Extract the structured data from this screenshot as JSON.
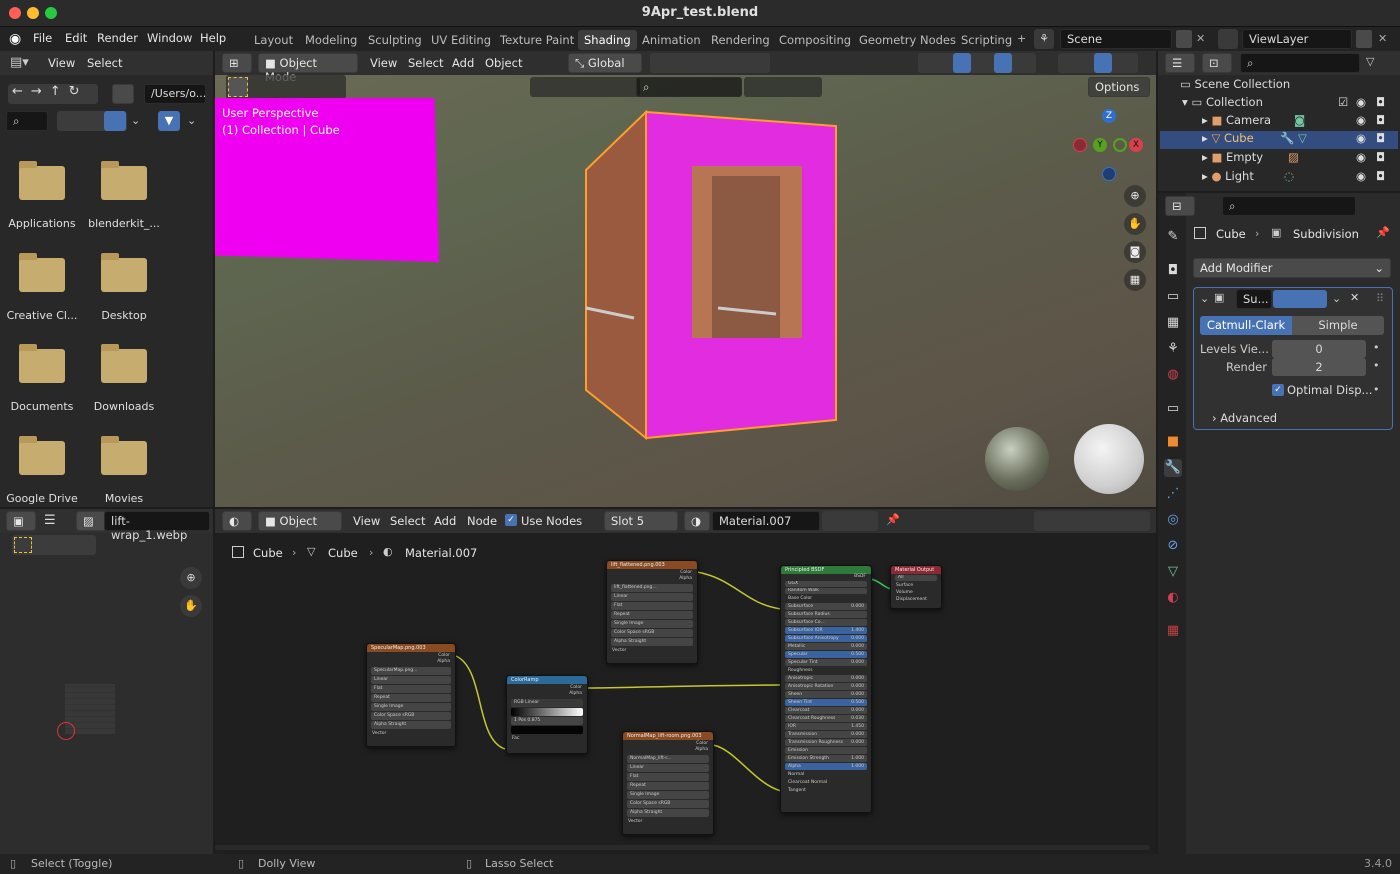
{
  "app": {
    "file_title": "9Apr_test.blend",
    "version": "3.4.0"
  },
  "menu": [
    "File",
    "Edit",
    "Render",
    "Window",
    "Help"
  ],
  "workspaces": [
    "Layout",
    "Modeling",
    "Sculpting",
    "UV Editing",
    "Texture Paint",
    "Shading",
    "Animation",
    "Rendering",
    "Compositing",
    "Geometry Nodes",
    "Scripting"
  ],
  "active_workspace": "Shading",
  "scene_field": "Scene",
  "viewlayer_field": "ViewLayer",
  "file_browser": {
    "menu": [
      "View",
      "Select"
    ],
    "path": "/Users/o...",
    "items": [
      "Applications",
      "blenderkit_...",
      "Creative Cl...",
      "Desktop",
      "Documents",
      "Downloads",
      "Google Drive",
      "Movies"
    ]
  },
  "viewport": {
    "mode": "Object Mode",
    "menu": [
      "View",
      "Select",
      "Add",
      "Object"
    ],
    "orientation": "Global",
    "options": "Options",
    "overlay_line1": "User Perspective",
    "overlay_line2": "(1) Collection | Cube"
  },
  "image_editor": {
    "image_name": "lift-wrap_1.webp"
  },
  "node_editor": {
    "type": "Object",
    "menu": [
      "View",
      "Select",
      "Add",
      "Node"
    ],
    "use_nodes": "Use Nodes",
    "slot": "Slot 5",
    "material": "Material.007",
    "breadcrumb": [
      "Cube",
      "Cube",
      "Material.007"
    ]
  },
  "nodes": {
    "lift": {
      "title": "lift_flattened.png.003",
      "image": "lift_flattened.png...",
      "outputs": [
        "Color",
        "Alpha"
      ],
      "rows": [
        "Linear",
        "Flat",
        "Repeat",
        "Single Image"
      ],
      "color_space": "Color Space",
      "color_space_val": "sRGB",
      "alpha": "Alpha",
      "alpha_val": "Straight",
      "input": "Vector"
    },
    "spec": {
      "title": "SpecularMap.png.003",
      "image": "SpecularMap.png...",
      "outputs": [
        "Color",
        "Alpha"
      ],
      "rows": [
        "Linear",
        "Flat",
        "Repeat",
        "Single Image"
      ],
      "color_space": "Color Space",
      "color_space_val": "sRGB",
      "alpha": "Alpha",
      "alpha_val": "Straight",
      "input": "Vector"
    },
    "ramp": {
      "title": "ColorRamp",
      "outputs": [
        "Color",
        "Alpha"
      ],
      "mode": "RGB",
      "interp": "Linear",
      "pos_label": "Pos",
      "pos_val": "0.875",
      "index": "1",
      "input": "Fac"
    },
    "normal": {
      "title": "NormalMap_lift-room.png.003",
      "image": "NormalMap_lift-r...",
      "outputs": [
        "Color",
        "Alpha"
      ],
      "rows": [
        "Linear",
        "Flat",
        "Repeat",
        "Single Image"
      ],
      "color_space": "Color Space",
      "color_space_val": "sRGB",
      "alpha": "Alpha",
      "alpha_val": "Straight",
      "input": "Vector"
    },
    "bsdf": {
      "title": "Principled BSDF",
      "output": "BSDF",
      "dist": "GGX",
      "sss": "Random Walk",
      "inputs": [
        [
          "Base Color",
          ""
        ],
        [
          "Subsurface",
          "0.000"
        ],
        [
          "Subsurface Radius",
          ""
        ],
        [
          "Subsurface Co...",
          ""
        ],
        [
          "Subsurface IOR",
          "1.400"
        ],
        [
          "Subsurface Anisotropy",
          "0.000"
        ],
        [
          "Metallic",
          "0.000"
        ],
        [
          "Specular",
          "0.500"
        ],
        [
          "Specular Tint",
          "0.000"
        ],
        [
          "Roughness",
          ""
        ],
        [
          "Anisotropic",
          "0.000"
        ],
        [
          "Anisotropic Rotation",
          "0.000"
        ],
        [
          "Sheen",
          "0.000"
        ],
        [
          "Sheen Tint",
          "0.500"
        ],
        [
          "Clearcoat",
          "0.000"
        ],
        [
          "Clearcoat Roughness",
          "0.030"
        ],
        [
          "IOR",
          "1.450"
        ],
        [
          "Transmission",
          "0.000"
        ],
        [
          "Transmission Roughness",
          "0.000"
        ],
        [
          "Emission",
          ""
        ],
        [
          "Emission Strength",
          "1.000"
        ],
        [
          "Alpha",
          "1.000"
        ],
        [
          "Normal",
          ""
        ],
        [
          "Clearcoat Normal",
          ""
        ],
        [
          "Tangent",
          ""
        ]
      ]
    },
    "output": {
      "title": "Material Output",
      "target": "All",
      "inputs": [
        "Surface",
        "Volume",
        "Displacement"
      ]
    }
  },
  "outliner": {
    "scene_collection": "Scene Collection",
    "collection": "Collection",
    "items": [
      "Camera",
      "Cube",
      "Empty",
      "Light"
    ],
    "selected": "Cube"
  },
  "properties": {
    "breadcrumb_obj": "Cube",
    "breadcrumb_mod": "Subdivision",
    "add_modifier": "Add Modifier",
    "modifier_name": "Su...",
    "catmull": "Catmull-Clark",
    "simple": "Simple",
    "levels_label": "Levels Vie...",
    "levels_val": "0",
    "render_label": "Render",
    "render_val": "2",
    "optimal": "Optimal Disp...",
    "advanced": "Advanced"
  },
  "status": {
    "left": "Select (Toggle)",
    "mid": "Dolly View",
    "right": "Lasso Select"
  }
}
